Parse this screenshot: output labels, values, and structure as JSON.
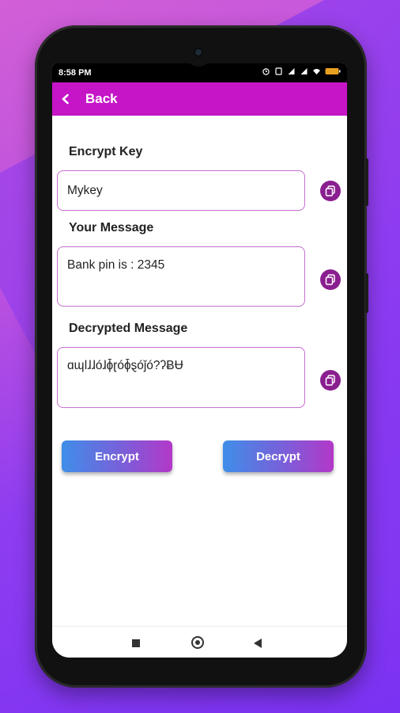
{
  "status_bar": {
    "time": "8:58 PM"
  },
  "header": {
    "back_label": "Back"
  },
  "fields": {
    "encrypt_key": {
      "label": "Encrypt Key",
      "value": "Mykey"
    },
    "your_message": {
      "label": "Your Message",
      "value": "Bank pin is : 2345"
    },
    "decrypted_message": {
      "label": "Decrypted Message",
      "value": "ɑɰǀɺɺóɺɸ̄ɽóɸ̄ȿóǰó?ʔɃɄ"
    }
  },
  "buttons": {
    "encrypt_label": "Encrypt",
    "decrypt_label": "Decrypt"
  },
  "colors": {
    "appbar": "#c515c7",
    "copy_button": "#8a1f8f",
    "field_border": "#c56fcf"
  },
  "icons": [
    "back-chevron-icon",
    "copy-icon",
    "nav-recent-icon",
    "nav-home-icon",
    "nav-back-icon"
  ]
}
